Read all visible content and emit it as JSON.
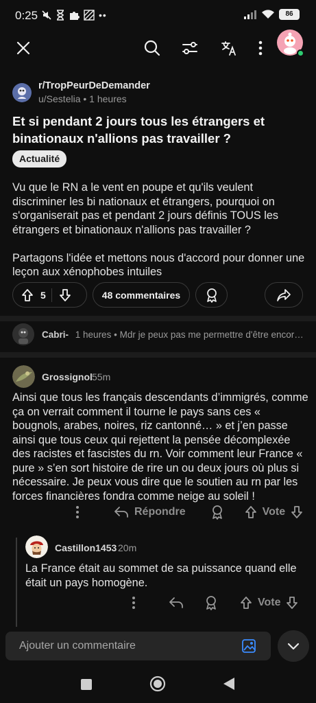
{
  "status_bar": {
    "time": "0:25",
    "battery": "86"
  },
  "post": {
    "subreddit": "r/TropPeurDeDemander",
    "author": "u/Sestelia",
    "time_ago": "1 heures",
    "title": "Et si pendant 2 jours tous les étrangers et binationaux n'allions pas travailler ?",
    "flair": "Actualité",
    "body_p1": "Vu que le RN a le vent en poupe et qu'ils veulent discriminer les bi nationaux et étrangers, pourquoi on s'organiserait pas et pendant 2 jours définis TOUS les étrangers et binationaux n'allions pas travailler ?",
    "body_p2": "Partagons l'idée et mettons nous d'accord pour donner une leçon aux xénophobes intuiles",
    "vote_count": "5",
    "comments_label": "48 commentaires"
  },
  "top_comment_preview": {
    "author": "Cabri-",
    "time_ago": "1 heures",
    "text": "Mdr je peux pas me permettre d'être encor…"
  },
  "comments": [
    {
      "author": "Grossignol",
      "time_ago": "55m",
      "body": "Ainsi que tous les français descendants d’immigrés, comme ça on verrait comment il tourne le pays sans ces « bougnols, arabes, noires, riz cantonné… » et j’en passe ainsi que tous ceux qui rejettent la pensée décomplexée des racistes et fascistes du rn. Voir comment leur France « pure » s’en sort histoire de rire un ou deux jours où plus si nécessaire. Je peux vous dire que le soutien au rn par les forces financières fondra comme neige au soleil !",
      "reply_label": "Répondre",
      "vote_label": "Vote"
    },
    {
      "author": "Castillon1453",
      "time_ago": "20m",
      "body": "La France était au sommet de sa puissance quand elle était un pays homogène.",
      "vote_label": "Vote"
    }
  ],
  "composer": {
    "placeholder": "Ajouter un commentaire"
  },
  "colors": {
    "background": "#0f0f0f",
    "accent_blue": "#3b8cff",
    "online_green": "#2ecc71",
    "avatar_pink": "#f5a3b4"
  }
}
